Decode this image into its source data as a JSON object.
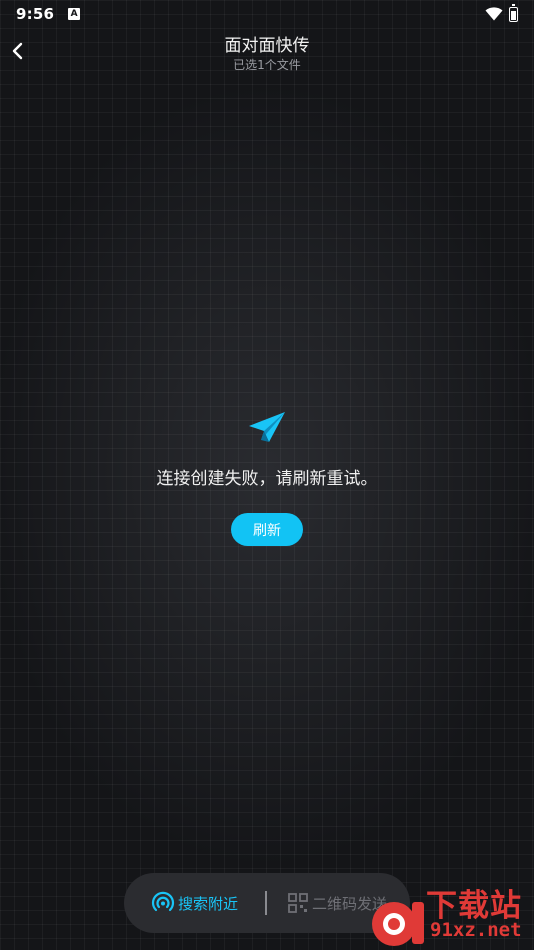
{
  "status_bar": {
    "time": "9:56",
    "notification_icon": "A",
    "icons": [
      "wifi-icon",
      "battery-charging-icon"
    ]
  },
  "header": {
    "title": "面对面快传",
    "subtitle": "已选1个文件",
    "back_icon": "chevron-left-icon"
  },
  "main": {
    "icon": "paper-plane-icon",
    "message": "连接创建失败，请刷新重试。",
    "refresh_label": "刷新"
  },
  "bottom_bar": {
    "search_label": "搜索附近",
    "search_icon": "nearby-signal-icon",
    "qr_label": "二维码发送",
    "qr_icon": "qr-code-icon"
  },
  "watermark": {
    "title": "下载站",
    "url": "91xz.net"
  },
  "colors": {
    "accent": "#12c3f4",
    "background": "#141518",
    "pill": "#2b2c30",
    "watermark": "#e03a37"
  }
}
